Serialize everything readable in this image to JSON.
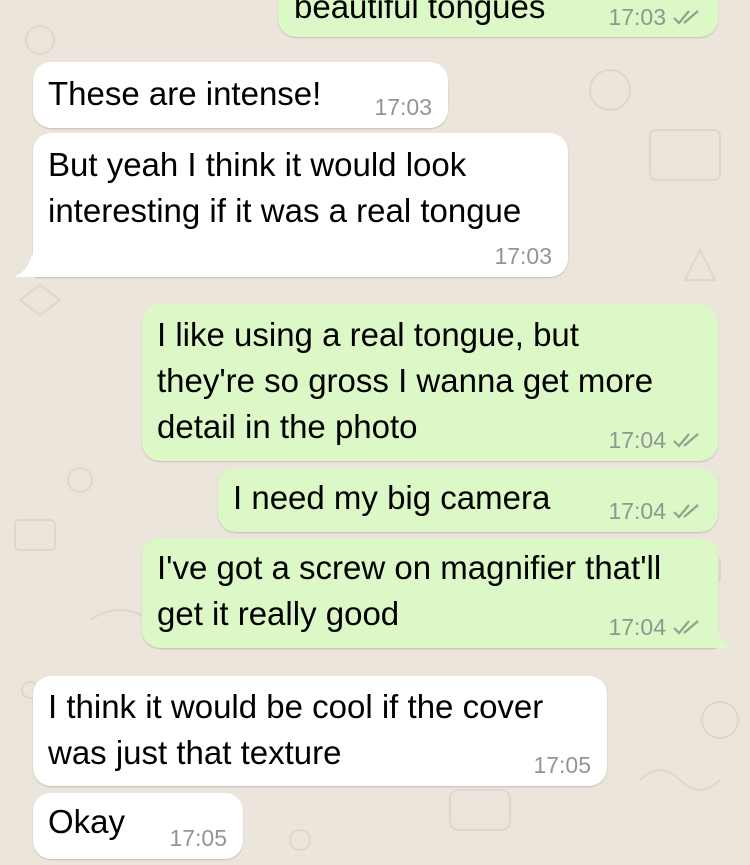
{
  "chat": {
    "messages": [
      {
        "direction": "outgoing",
        "lines": [
          "beautiful tongues"
        ],
        "time": "17:03",
        "status_icon": "double-check-icon"
      },
      {
        "direction": "incoming",
        "lines": [
          "These are intense!"
        ],
        "time": "17:03"
      },
      {
        "direction": "incoming",
        "lines": [
          "But yeah I think it would look",
          "interesting if it was a real tongue"
        ],
        "time": "17:03"
      },
      {
        "direction": "outgoing",
        "lines": [
          "I like using a real tongue, but",
          "they're so gross I wanna get more",
          "detail in the photo"
        ],
        "time": "17:04",
        "status_icon": "double-check-icon"
      },
      {
        "direction": "outgoing",
        "lines": [
          "I need my big camera"
        ],
        "time": "17:04",
        "status_icon": "double-check-icon"
      },
      {
        "direction": "outgoing",
        "lines": [
          "I've got a screw on magnifier that'll",
          "get it really good"
        ],
        "time": "17:04",
        "status_icon": "double-check-icon"
      },
      {
        "direction": "incoming",
        "lines": [
          "I think it would be cool if the cover",
          "was just that texture"
        ],
        "time": "17:05"
      },
      {
        "direction": "incoming",
        "lines": [
          "Okay"
        ],
        "time": "17:05"
      }
    ]
  },
  "colors": {
    "background": "#ece5dc",
    "incoming_bubble": "#ffffff",
    "outgoing_bubble": "#dcf8c6",
    "timestamp": "#909790",
    "tick": "#8fa38f"
  }
}
